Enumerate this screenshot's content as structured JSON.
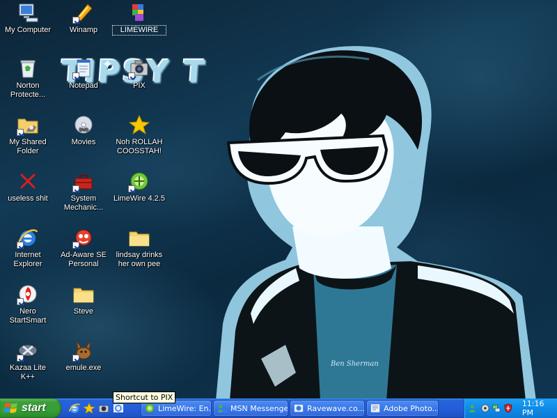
{
  "desktop": {
    "wallpaper_title": "TIPSY T",
    "wallpaper_shirt_text": "Ben Sherman",
    "icons": [
      {
        "label": "My Computer",
        "icon": "computer-icon"
      },
      {
        "label": "Winamp",
        "icon": "winamp-icon"
      },
      {
        "label": "LIMEWIRE",
        "icon": "limewire-folder-icon"
      },
      {
        "label": "Norton Protecte...",
        "icon": "recycle-bin-icon"
      },
      {
        "label": "Notepad",
        "icon": "notepad-icon"
      },
      {
        "label": "PIX",
        "icon": "camera-icon"
      },
      {
        "label": "My Shared Folder",
        "icon": "shared-folder-icon"
      },
      {
        "label": "Movies",
        "icon": "dvd-icon"
      },
      {
        "label": "Noh ROLLAH COOSSTAH!",
        "icon": "star-icon"
      },
      {
        "label": "useless shit",
        "icon": "red-x-icon"
      },
      {
        "label": "System Mechanic...",
        "icon": "toolbox-icon"
      },
      {
        "label": "LimeWire 4.2.5",
        "icon": "limewire-icon"
      },
      {
        "label": "Internet Explorer",
        "icon": "internet-explorer-icon"
      },
      {
        "label": "Ad-Aware SE Personal",
        "icon": "adaware-icon"
      },
      {
        "label": "lindsay drinks her own pee",
        "icon": "folder-icon"
      },
      {
        "label": "Nero StartSmart",
        "icon": "nero-icon"
      },
      {
        "label": "Steve",
        "icon": "folder-icon"
      },
      {
        "label": "Kazaa Lite K++",
        "icon": "kazaa-icon"
      },
      {
        "label": "emule.exe",
        "icon": "emule-icon"
      }
    ]
  },
  "tooltip": "Shortcut to PIX",
  "taskbar": {
    "start_label": "start",
    "quick_launch": [
      "internet-explorer-icon",
      "star-icon",
      "camera-icon",
      "ie-refresh-icon"
    ],
    "tasks": [
      {
        "label": "LimeWire: En...",
        "icon": "limewire-icon"
      },
      {
        "label": "MSN Messenger",
        "icon": "msn-icon"
      },
      {
        "label": "Ravewave.co...",
        "icon": "internet-explorer-icon"
      },
      {
        "label": "Adobe Photo...",
        "icon": "photoshop-icon"
      }
    ],
    "tray_icons": [
      "people-icon",
      "speaker-icon",
      "network-icon",
      "shield-icon"
    ],
    "clock": "11:16 PM"
  }
}
